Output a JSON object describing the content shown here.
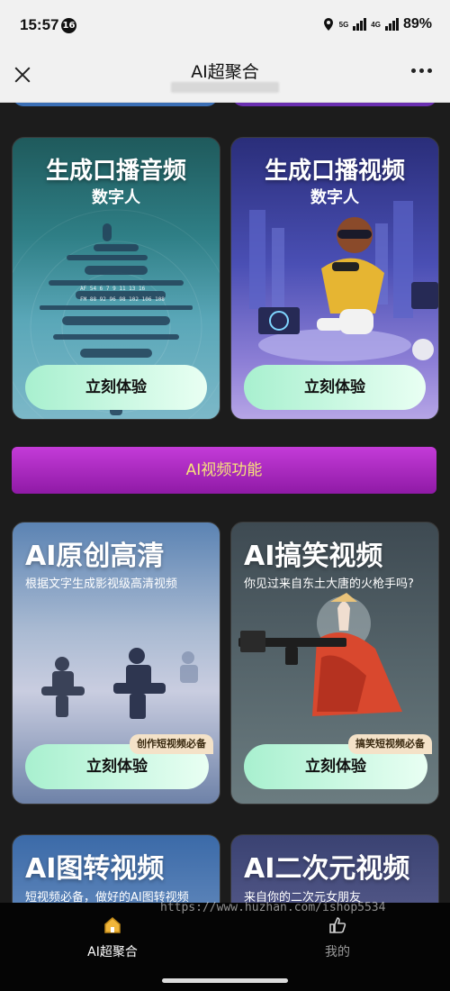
{
  "status": {
    "time": "15:57",
    "notif_count": "16",
    "network": "5G",
    "network2": "4G",
    "battery": "89%"
  },
  "titlebar": {
    "title": "AI超聚合"
  },
  "cards_top": [
    {
      "title": "生成口播音频",
      "subtitle": "数字人",
      "button": "立刻体验",
      "waveform_text_1": "AF  54  6  7  9  11  13  16",
      "waveform_text_2": "FM  88  92  96  98  102  106  108"
    },
    {
      "title": "生成口播视频",
      "subtitle": "数字人",
      "button": "立刻体验"
    }
  ],
  "banner": {
    "label": "AI视频功能"
  },
  "cards_mid": [
    {
      "title": "AI原创高清",
      "desc": "根据文字生成影视级高清视频",
      "tag": "创作短视频必备",
      "button": "立刻体验"
    },
    {
      "title": "AI搞笑视频",
      "desc": "你见过来自东土大唐的火枪手吗?",
      "tag": "搞笑短视频必备",
      "button": "立刻体验"
    }
  ],
  "cards_bottom": [
    {
      "title": "AI图转视频",
      "desc": "短视频必备，做好的AI图转视频"
    },
    {
      "title": "AI二次元视频",
      "desc": "来自你的二次元女朋友"
    }
  ],
  "watermark": "https://www.huzhan.com/ishop5534",
  "tabbar": {
    "home_label": "AI超聚合",
    "mine_label": "我的"
  },
  "colors": {
    "banner_start": "#c43bd8",
    "banner_end": "#8f1aa6",
    "banner_text": "#f6e27a",
    "button_start": "#a8f0cf",
    "button_end": "#e9fff3",
    "tab_active": "#ffffff",
    "tab_inactive": "#9a9a9a",
    "home_icon": "#f0b63a"
  }
}
